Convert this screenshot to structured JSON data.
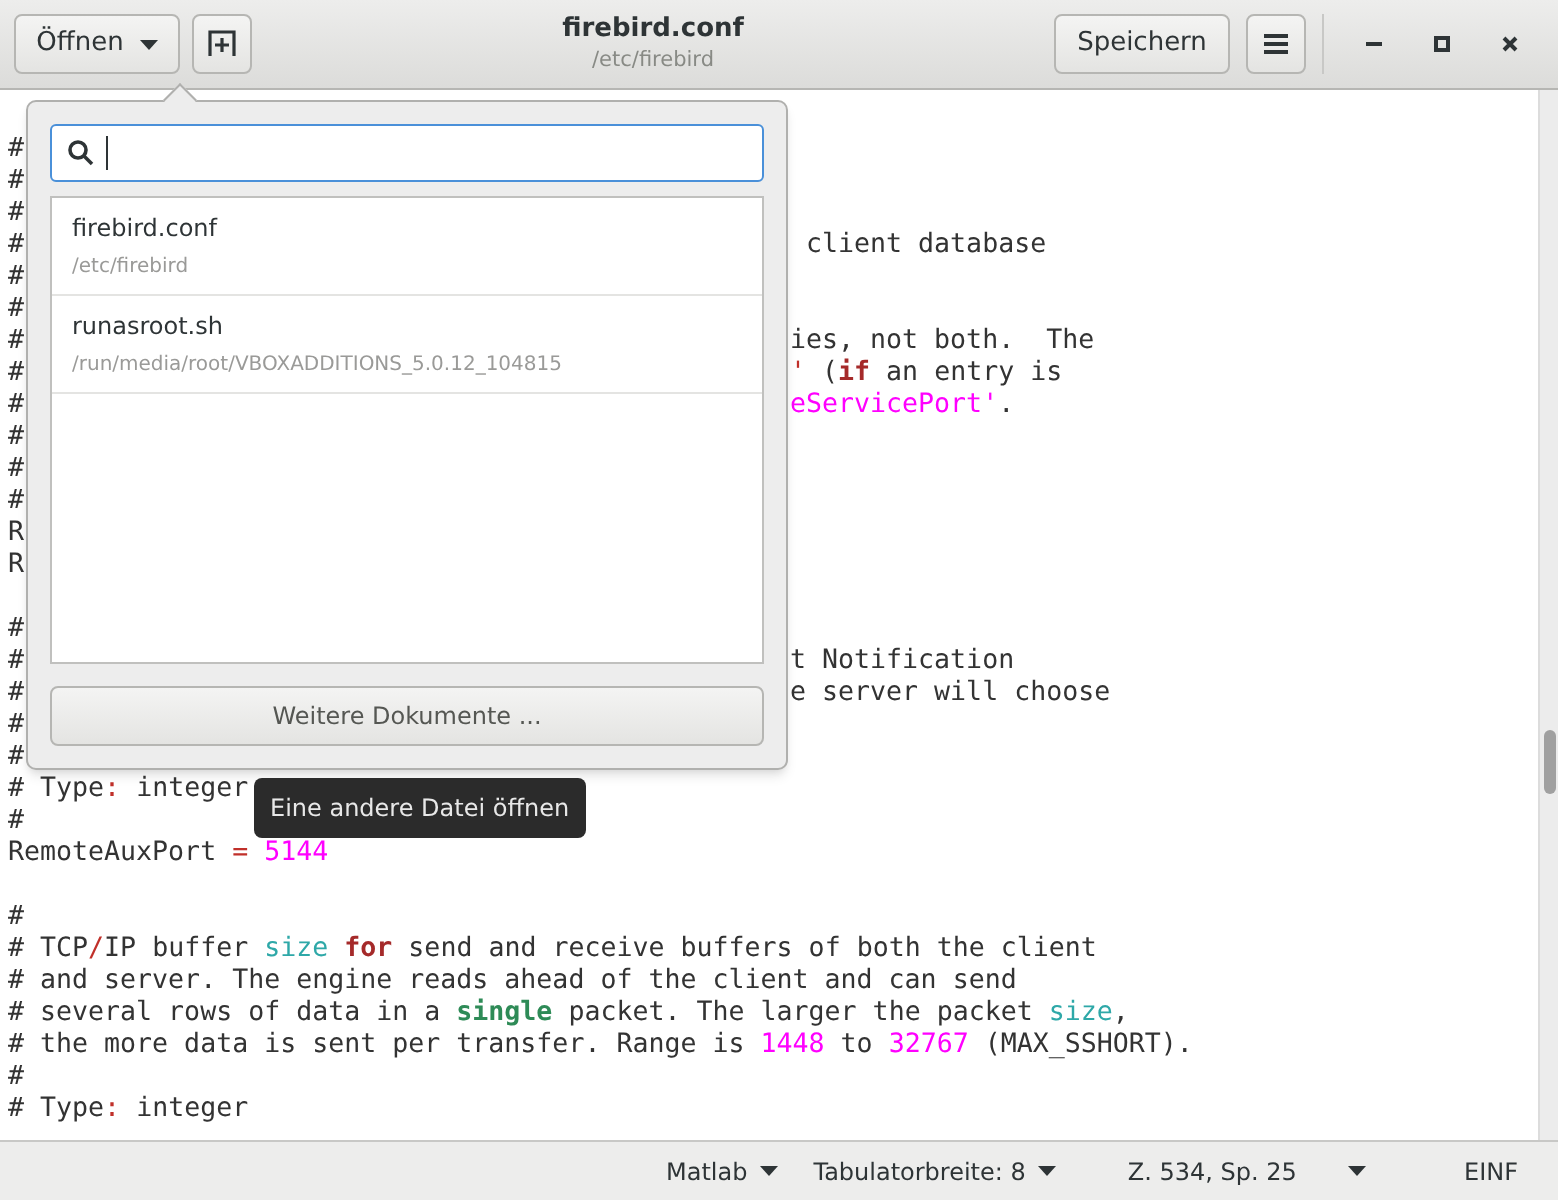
{
  "header": {
    "open_button": {
      "label": "Öffnen"
    },
    "title": "firebird.conf",
    "subtitle": "/etc/firebird",
    "save_button": {
      "label": "Speichern"
    }
  },
  "editor": {
    "lines": [
      {
        "left": [
          {
            "kind": "text",
            "text": "#"
          }
        ]
      },
      {
        "left": [
          {
            "kind": "text",
            "text": "#"
          }
        ]
      },
      {
        "left": [
          {
            "kind": "text",
            "text": "#"
          }
        ]
      },
      {
        "left": [
          {
            "kind": "text",
            "text": "#"
          }
        ],
        "right": [
          {
            "kind": "text",
            "text": " client database"
          }
        ]
      },
      {
        "left": [
          {
            "kind": "text",
            "text": "#"
          }
        ]
      },
      {
        "left": [
          {
            "kind": "text",
            "text": "#"
          }
        ]
      },
      {
        "left": [
          {
            "kind": "text",
            "text": "#"
          }
        ],
        "right": [
          {
            "kind": "text",
            "text": "ies, not both.  The"
          }
        ]
      },
      {
        "left": [
          {
            "kind": "text",
            "text": "#"
          }
        ],
        "right": [
          {
            "kind": "operator",
            "text": "'"
          },
          {
            "kind": "text",
            "text": " ("
          },
          {
            "kind": "keyword",
            "text": "if"
          },
          {
            "kind": "text",
            "text": " an entry is"
          }
        ]
      },
      {
        "left": [
          {
            "kind": "text",
            "text": "#"
          }
        ],
        "right": [
          {
            "kind": "string",
            "text": "eServicePort'"
          },
          {
            "kind": "text",
            "text": "."
          }
        ]
      },
      {
        "left": [
          {
            "kind": "text",
            "text": "#"
          }
        ]
      },
      {
        "left": [
          {
            "kind": "text",
            "text": "#"
          }
        ]
      },
      {
        "left": [
          {
            "kind": "text",
            "text": "#"
          }
        ]
      },
      {
        "left": [
          {
            "kind": "text",
            "text": "R"
          }
        ]
      },
      {
        "left": [
          {
            "kind": "text",
            "text": "R"
          }
        ]
      },
      {
        "space_above": true,
        "left": [
          {
            "kind": "text",
            "text": "#"
          }
        ]
      },
      {
        "left": [
          {
            "kind": "text",
            "text": "#"
          }
        ],
        "right": [
          {
            "kind": "text",
            "text": "t Notification"
          }
        ]
      },
      {
        "left": [
          {
            "kind": "text",
            "text": "#"
          }
        ],
        "right": [
          {
            "kind": "text",
            "text": "e server will choose"
          }
        ]
      },
      {
        "left": [
          {
            "kind": "text",
            "text": "#"
          }
        ]
      },
      {
        "left": [
          {
            "kind": "text",
            "text": "#"
          }
        ]
      },
      {
        "left": [
          {
            "kind": "text",
            "text": "# Type"
          },
          {
            "kind": "operator",
            "text": ":"
          },
          {
            "kind": "text",
            "text": " integer"
          }
        ]
      },
      {
        "left": [
          {
            "kind": "text",
            "text": "#"
          }
        ]
      },
      {
        "left": [
          {
            "kind": "text",
            "text": "RemoteAuxPort "
          },
          {
            "kind": "operator",
            "text": "= "
          },
          {
            "kind": "number",
            "text": "5144"
          }
        ]
      },
      {
        "space_above": true,
        "left": [
          {
            "kind": "text",
            "text": "#"
          }
        ]
      },
      {
        "left": [
          {
            "kind": "text",
            "text": "# TCP"
          },
          {
            "kind": "operator",
            "text": "/"
          },
          {
            "kind": "text",
            "text": "IP buffer "
          },
          {
            "kind": "builtin",
            "text": "size "
          },
          {
            "kind": "keyword",
            "text": "for"
          },
          {
            "kind": "text",
            "text": " send and receive buffers of both the client"
          }
        ]
      },
      {
        "left": [
          {
            "kind": "text",
            "text": "# and server. The engine reads ahead of the client and can send"
          }
        ]
      },
      {
        "left": [
          {
            "kind": "text",
            "text": "# several rows of data in a "
          },
          {
            "kind": "special",
            "text": "single"
          },
          {
            "kind": "text",
            "text": " packet. The larger the packet "
          },
          {
            "kind": "builtin",
            "text": "size"
          },
          {
            "kind": "text",
            "text": ","
          }
        ]
      },
      {
        "left": [
          {
            "kind": "text",
            "text": "# the more data is sent per transfer. Range is "
          },
          {
            "kind": "number",
            "text": "1448"
          },
          {
            "kind": "text",
            "text": " to "
          },
          {
            "kind": "number",
            "text": "32767"
          },
          {
            "kind": "text",
            "text": " (MAX_SSHORT)."
          }
        ]
      },
      {
        "left": [
          {
            "kind": "text",
            "text": "#"
          }
        ]
      },
      {
        "left": [
          {
            "kind": "text",
            "text": "# Type"
          },
          {
            "kind": "operator",
            "text": ":"
          },
          {
            "kind": "text",
            "text": " integer"
          }
        ]
      }
    ]
  },
  "popover": {
    "search": {
      "focused": true
    },
    "recent_files": [
      {
        "name": "firebird.conf",
        "path": "/etc/firebird"
      },
      {
        "name": "runasroot.sh",
        "path": "/run/media/root/VBOXADDITIONS_5.0.12_104815"
      }
    ],
    "more_button": "Weitere Dokumente ..."
  },
  "tooltip": "Eine andere Datei öffnen",
  "status_bar": {
    "language": "Matlab",
    "tab_width": "Tabulatorbreite: 8",
    "position": "Z. 534, Sp. 25",
    "mode": "EINF"
  }
}
